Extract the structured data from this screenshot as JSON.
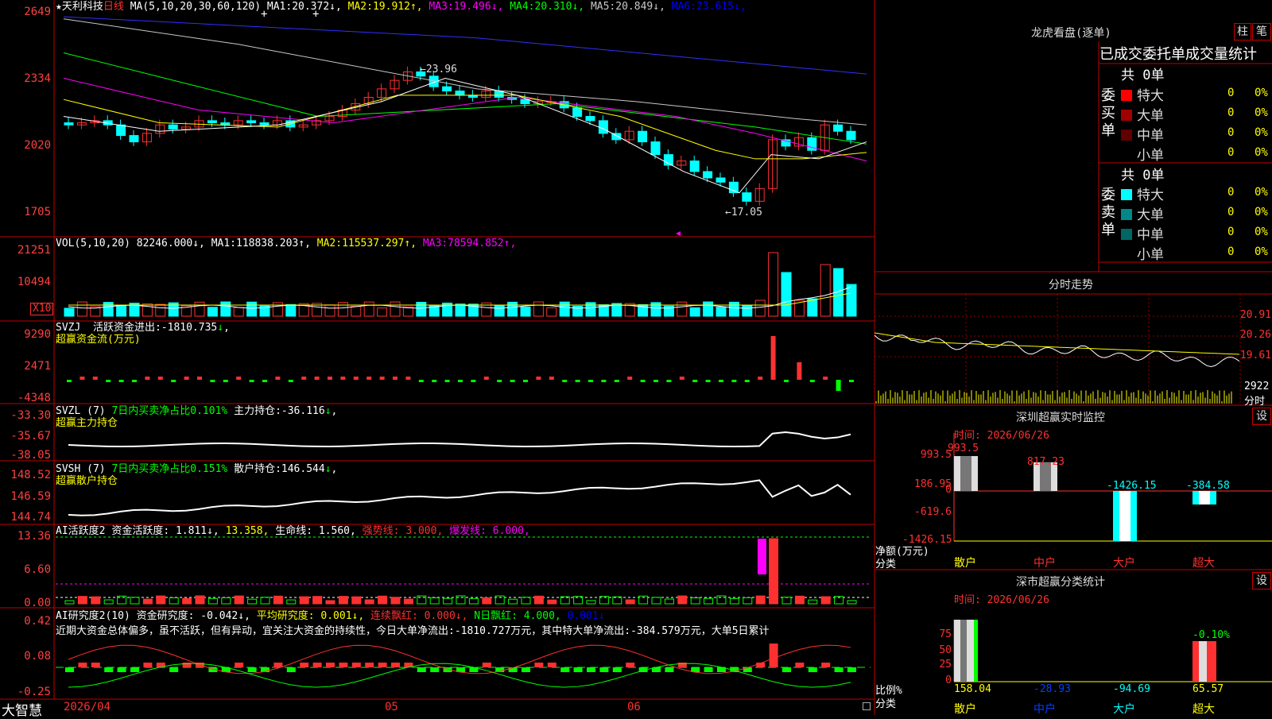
{
  "stock": {
    "star": "★",
    "name": "天利科技",
    "period": "日线"
  },
  "ma_header": {
    "params": "MA(5,10,20,30,60,120)",
    "items": [
      {
        "label": "MA1:",
        "value": "20.372",
        "arrow": "↓",
        "color": "#ffffff"
      },
      {
        "label": "MA2:",
        "value": "19.912",
        "arrow": "↑",
        "color": "#ffff00"
      },
      {
        "label": "MA3:",
        "value": "19.496",
        "arrow": "↓",
        "color": "#ff00ff"
      },
      {
        "label": "MA4:",
        "value": "20.310",
        "arrow": "↓",
        "color": "#00ff00"
      },
      {
        "label": "MA5:",
        "value": "20.849",
        "arrow": "↓",
        "color": "#c8c8c8"
      },
      {
        "label": "MA6:",
        "value": "23.615",
        "arrow": "↓",
        "color": "#0000ff"
      }
    ]
  },
  "price_axis": [
    "2649",
    "2334",
    "2020",
    "1705"
  ],
  "annotations": {
    "high": "23.96",
    "low": "17.05"
  },
  "vol_header": {
    "params": "VOL(5,10,20)",
    "value": "82246.000",
    "arrow": "↓",
    "items": [
      {
        "label": "MA1:",
        "value": "118838.203",
        "arrow": "↑",
        "color": "#ffffff"
      },
      {
        "label": "MA2:",
        "value": "115537.297",
        "arrow": "↑",
        "color": "#ffff00"
      },
      {
        "label": "MA3:",
        "value": "78594.852",
        "arrow": "↑",
        "color": "#ff00ff"
      }
    ]
  },
  "vol_axis": [
    "21251",
    "10494"
  ],
  "vol_unit": "X10",
  "svzj": {
    "line1_prefix": "SVZJ",
    "line1_label": "活跃资金进出:",
    "value": "-1810.735",
    "arrow": "↓",
    "line2": "超赢资金流(万元)",
    "axis": [
      "9290",
      "2471",
      "-4348"
    ]
  },
  "svzl": {
    "prefix": "SVZL (7)",
    "desc": "7日内买卖净占比0.101%",
    "label": "主力持仓:",
    "value": "-36.116",
    "arrow": "↓",
    "line2": "超赢主力持仓",
    "axis": [
      "-33.30",
      "-35.67",
      "-38.05"
    ]
  },
  "svsh": {
    "prefix": "SVSH (7)",
    "desc": "7日内买卖净占比0.151%",
    "label": "散户持仓:",
    "value": "146.544",
    "arrow": "↓",
    "line2": "超赢散户持仓",
    "axis": [
      "148.52",
      "146.59",
      "144.74"
    ]
  },
  "ai_active": {
    "prefix": "AI活跃度2",
    "items": [
      {
        "text": "资金活跃度: 1.811↓,",
        "color": "#ffffff"
      },
      {
        "text": "13.358,",
        "color": "#ffff00"
      },
      {
        "text": "生命线: 1.560,",
        "color": "#ffffff"
      },
      {
        "text": "强势线: 3.000,",
        "color": "#ff3030"
      },
      {
        "text": "爆发线: 6.000,",
        "color": "#ff00ff"
      }
    ],
    "axis": [
      "13.36",
      "6.60",
      "0.00"
    ]
  },
  "ai_research": {
    "prefix": "AI研究度2(10)",
    "items": [
      {
        "text": "资金研究度: -0.042↓,",
        "color": "#ffffff"
      },
      {
        "text": "平均研究度: 0.001↓,",
        "color": "#ffff00"
      },
      {
        "text": "连续飘红: 0.000↓,",
        "color": "#ff3030"
      },
      {
        "text": "N日飘红: 4.000,",
        "color": "#00ff00"
      },
      {
        "text": "0.001↓",
        "color": "#0000ff"
      }
    ],
    "summary": "近期大资金总体偏多，虽不活跃，但有异动，宜关注大资金的持续性，今日大单净流出:-1810.727万元，其中特大单净流出:-384.579万元，大单5日累计",
    "axis": [
      "0.42",
      "0.08",
      "-0.25"
    ]
  },
  "bottom_bar": {
    "brand": "大智慧",
    "dates": [
      "2026/04",
      "05",
      "06"
    ]
  },
  "lhkp": {
    "title": "龙虎看盘(逐单)",
    "btn1": "柱",
    "btn2": "笔",
    "subtitle": "已成交委托单成交量统计",
    "buy": {
      "side": "委买单",
      "total": "共 0单",
      "rows": [
        {
          "label": "特大",
          "count": "0",
          "pct": "0%",
          "color": "#ff0000"
        },
        {
          "label": "大单",
          "count": "0",
          "pct": "0%",
          "color": "#a00000"
        },
        {
          "label": "中单",
          "count": "0",
          "pct": "0%",
          "color": "#600000"
        },
        {
          "label": "小单",
          "count": "0",
          "pct": "0%",
          "color": "#000000"
        }
      ]
    },
    "sell": {
      "side": "委卖单",
      "total": "共 0单",
      "rows": [
        {
          "label": "特大",
          "count": "0",
          "pct": "0%",
          "color": "#00ffff"
        },
        {
          "label": "大单",
          "count": "0",
          "pct": "0%",
          "color": "#008888"
        },
        {
          "label": "中单",
          "count": "0",
          "pct": "0%",
          "color": "#006666"
        },
        {
          "label": "小单",
          "count": "0",
          "pct": "0%",
          "color": "#000000"
        }
      ]
    }
  },
  "intraday": {
    "title": "分时走势",
    "axis": [
      "20.91",
      "20.26",
      "19.61"
    ],
    "vol_axis": "2922",
    "vol_label": "分时"
  },
  "sz_monitor": {
    "title": "深圳超赢实时监控",
    "btn": "设",
    "time": "时间: 2026/06/26",
    "axis": [
      "993.5",
      "186.95",
      "0",
      "-619.6",
      "-1426.15"
    ],
    "y_label1": "净额(万元)",
    "y_label2": "分类",
    "bars": [
      {
        "name": "散户",
        "value": 993.5,
        "label": "993.5"
      },
      {
        "name": "中户",
        "value": 817.23,
        "label": "817.23"
      },
      {
        "name": "大户",
        "value": -1426.15,
        "label": "-1426.15"
      },
      {
        "name": "超大",
        "value": -384.58,
        "label": "-384.58"
      }
    ]
  },
  "sz_class": {
    "title": "深市超赢分类统计",
    "btn": "设",
    "time": "时间: 2026/06/26",
    "axis": [
      "75",
      "50",
      "25",
      "0"
    ],
    "y_label1": "比例%",
    "y_label2": "分类",
    "bar_top_label": "-0.10%",
    "cats": [
      {
        "name": "散户",
        "value": "158.04",
        "color": "#ffff00"
      },
      {
        "name": "中户",
        "value": "-28.93",
        "color": "#0040ff"
      },
      {
        "name": "大户",
        "value": "-94.69",
        "color": "#00ffff"
      },
      {
        "name": "超大",
        "value": "65.57",
        "color": "#ffff00"
      }
    ]
  }
}
